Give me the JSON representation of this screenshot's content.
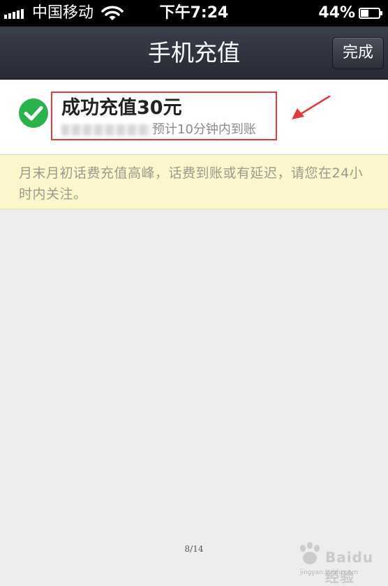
{
  "status_bar": {
    "carrier": "中国移动",
    "time": "下午7:24",
    "battery_percent": "44%",
    "signal_bars": 5,
    "battery_level": 0.44
  },
  "nav": {
    "title": "手机充值",
    "done_label": "完成"
  },
  "result": {
    "title": "成功充值30元",
    "arrival_note": "预计10分钟内到账"
  },
  "notice": {
    "text": "月末月初话费充值高峰，话费到账或有延迟，请您在24小时内关注。"
  },
  "footer": {
    "page_indicator": "8/14",
    "watermark_text": "Baidu经验",
    "watermark_url": "jingyan.baidu.com"
  },
  "colors": {
    "status_bar_bg": "#000000",
    "nav_bar_bg": "#2f333d",
    "success_green": "#2bb24c",
    "notice_bg": "#fcf6cd",
    "annotation_red": "#e23b3b",
    "page_bg": "#ededed"
  },
  "icons": {
    "signal": "signal-bars-icon",
    "wifi": "wifi-icon",
    "battery": "battery-icon",
    "success": "check-circle-icon",
    "annotation": "red-arrow-icon",
    "watermark": "baidu-paw-icon"
  }
}
